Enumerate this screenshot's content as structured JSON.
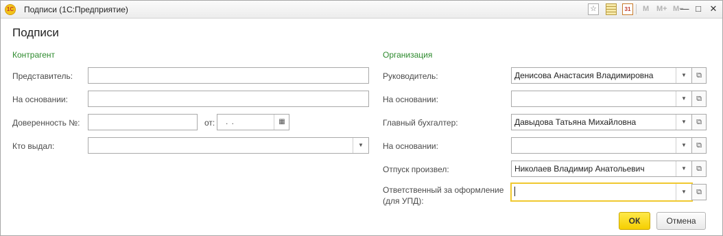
{
  "window": {
    "title": "Подписи  (1С:Предприятие)",
    "logo_text": "1С",
    "memory_buttons": [
      "M",
      "M+",
      "M−"
    ],
    "calendar_icon_text": "31"
  },
  "heading": "Подписи",
  "contractor": {
    "section_label": "Контрагент",
    "representative": {
      "label": "Представитель:",
      "value": ""
    },
    "basis": {
      "label": "На основании:",
      "value": ""
    },
    "power_of_attorney": {
      "label": "Доверенность №:",
      "value": "",
      "date_label": "от:",
      "date_value": ". ."
    },
    "issued_by": {
      "label": "Кто выдал:",
      "value": ""
    }
  },
  "organization": {
    "section_label": "Организация",
    "head": {
      "label": "Руководитель:",
      "value": "Денисова Анастасия Владимировна"
    },
    "head_basis": {
      "label": "На основании:",
      "value": ""
    },
    "chief_accountant": {
      "label": "Главный бухгалтер:",
      "value": "Давыдова Татьяна Михайловна"
    },
    "accountant_basis": {
      "label": "На основании:",
      "value": ""
    },
    "released_by": {
      "label": "Отпуск произвел:",
      "value": "Николаев Владимир Анатольевич"
    },
    "responsible": {
      "label_line1": "Ответственный за оформление",
      "label_line2": "(для УПД):",
      "value": ""
    }
  },
  "buttons": {
    "ok": "ОК",
    "cancel": "Отмена"
  },
  "colors": {
    "section": "#2d8a2d",
    "ok_button": "#f5cf00",
    "focus_border": "#f0c82e"
  }
}
